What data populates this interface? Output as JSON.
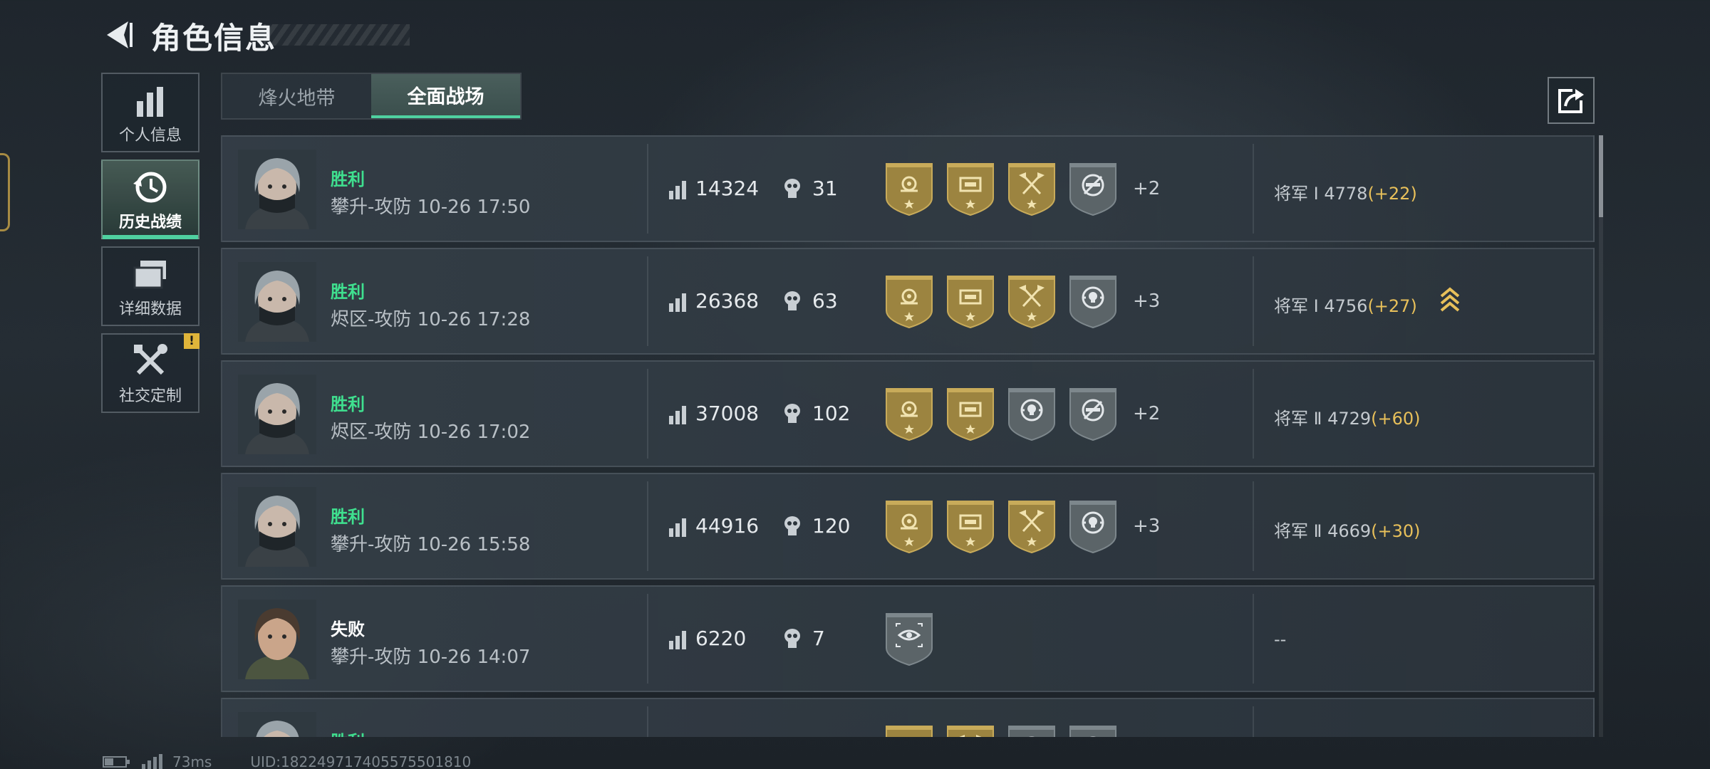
{
  "header": {
    "title": "角色信息",
    "back_icon": "back-arrow-icon"
  },
  "sidebar": {
    "items": [
      {
        "label": "个人信息",
        "icon": "bar-chart-icon",
        "active": false,
        "warning": ""
      },
      {
        "label": "历史战绩",
        "icon": "history-clock-icon",
        "active": true,
        "warning": ""
      },
      {
        "label": "详细数据",
        "icon": "folder-stack-icon",
        "active": false,
        "warning": ""
      },
      {
        "label": "社交定制",
        "icon": "tools-icon",
        "active": false,
        "warning": "!"
      }
    ]
  },
  "tabs": [
    {
      "label": "烽火地带",
      "active": false
    },
    {
      "label": "全面战场",
      "active": true
    }
  ],
  "share": {
    "icon": "share-export-icon"
  },
  "matches": [
    {
      "result": "胜利",
      "win": true,
      "mode": "攀升-攻防",
      "time": "10-26 17:50",
      "score": "14324",
      "kills": "31",
      "medals": [
        "rose-medal",
        "tank-medal",
        "axe-medal",
        "gray-no-gun-medal"
      ],
      "more": "+2",
      "rank": "将军 Ⅰ",
      "points": "4778",
      "delta": "(+22)",
      "rank_up": false
    },
    {
      "result": "胜利",
      "win": true,
      "mode": "烬区-攻防",
      "time": "10-26 17:28",
      "score": "26368",
      "kills": "63",
      "medals": [
        "rose-medal",
        "tank-medal",
        "axe-medal",
        "gray-skull-target-medal"
      ],
      "more": "+3",
      "rank": "将军 Ⅰ",
      "points": "4756",
      "delta": "(+27)",
      "rank_up": true
    },
    {
      "result": "胜利",
      "win": true,
      "mode": "烬区-攻防",
      "time": "10-26 17:02",
      "score": "37008",
      "kills": "102",
      "medals": [
        "rose-medal",
        "tank-medal",
        "gray-skull-target-medal",
        "gray-no-gun-medal"
      ],
      "more": "+2",
      "rank": "将军 Ⅱ",
      "points": "4729",
      "delta": "(+60)",
      "rank_up": false
    },
    {
      "result": "胜利",
      "win": true,
      "mode": "攀升-攻防",
      "time": "10-26 15:58",
      "score": "44916",
      "kills": "120",
      "medals": [
        "rose-medal",
        "tank-medal",
        "axe-medal",
        "gray-skull-target-medal"
      ],
      "more": "+3",
      "rank": "将军 Ⅱ",
      "points": "4669",
      "delta": "(+30)",
      "rank_up": false
    },
    {
      "result": "失败",
      "win": false,
      "mode": "攀升-攻防",
      "time": "10-26 14:07",
      "score": "6220",
      "kills": "7",
      "medals": [
        "gray-eye-target-medal"
      ],
      "more": "",
      "rank": "--",
      "points": "",
      "delta": "",
      "rank_up": false
    },
    {
      "result": "胜利",
      "win": true,
      "mode": "",
      "time": "",
      "score": "",
      "kills": "",
      "medals": [
        "tank-medal",
        "axe-medal",
        "gray-skull-target-medal",
        "gray-no-gun-medal"
      ],
      "more": "",
      "rank": "",
      "points": "",
      "delta": "",
      "rank_up": false
    }
  ],
  "status": {
    "ping": "73ms",
    "uid": "UID:18224971740557550181​0"
  },
  "colors": {
    "win": "#3fe08f",
    "accent": "#4fd1a0",
    "gold": "#e8c05a",
    "medal_gold": "#9c8440",
    "medal_gray": "#5b6468"
  }
}
